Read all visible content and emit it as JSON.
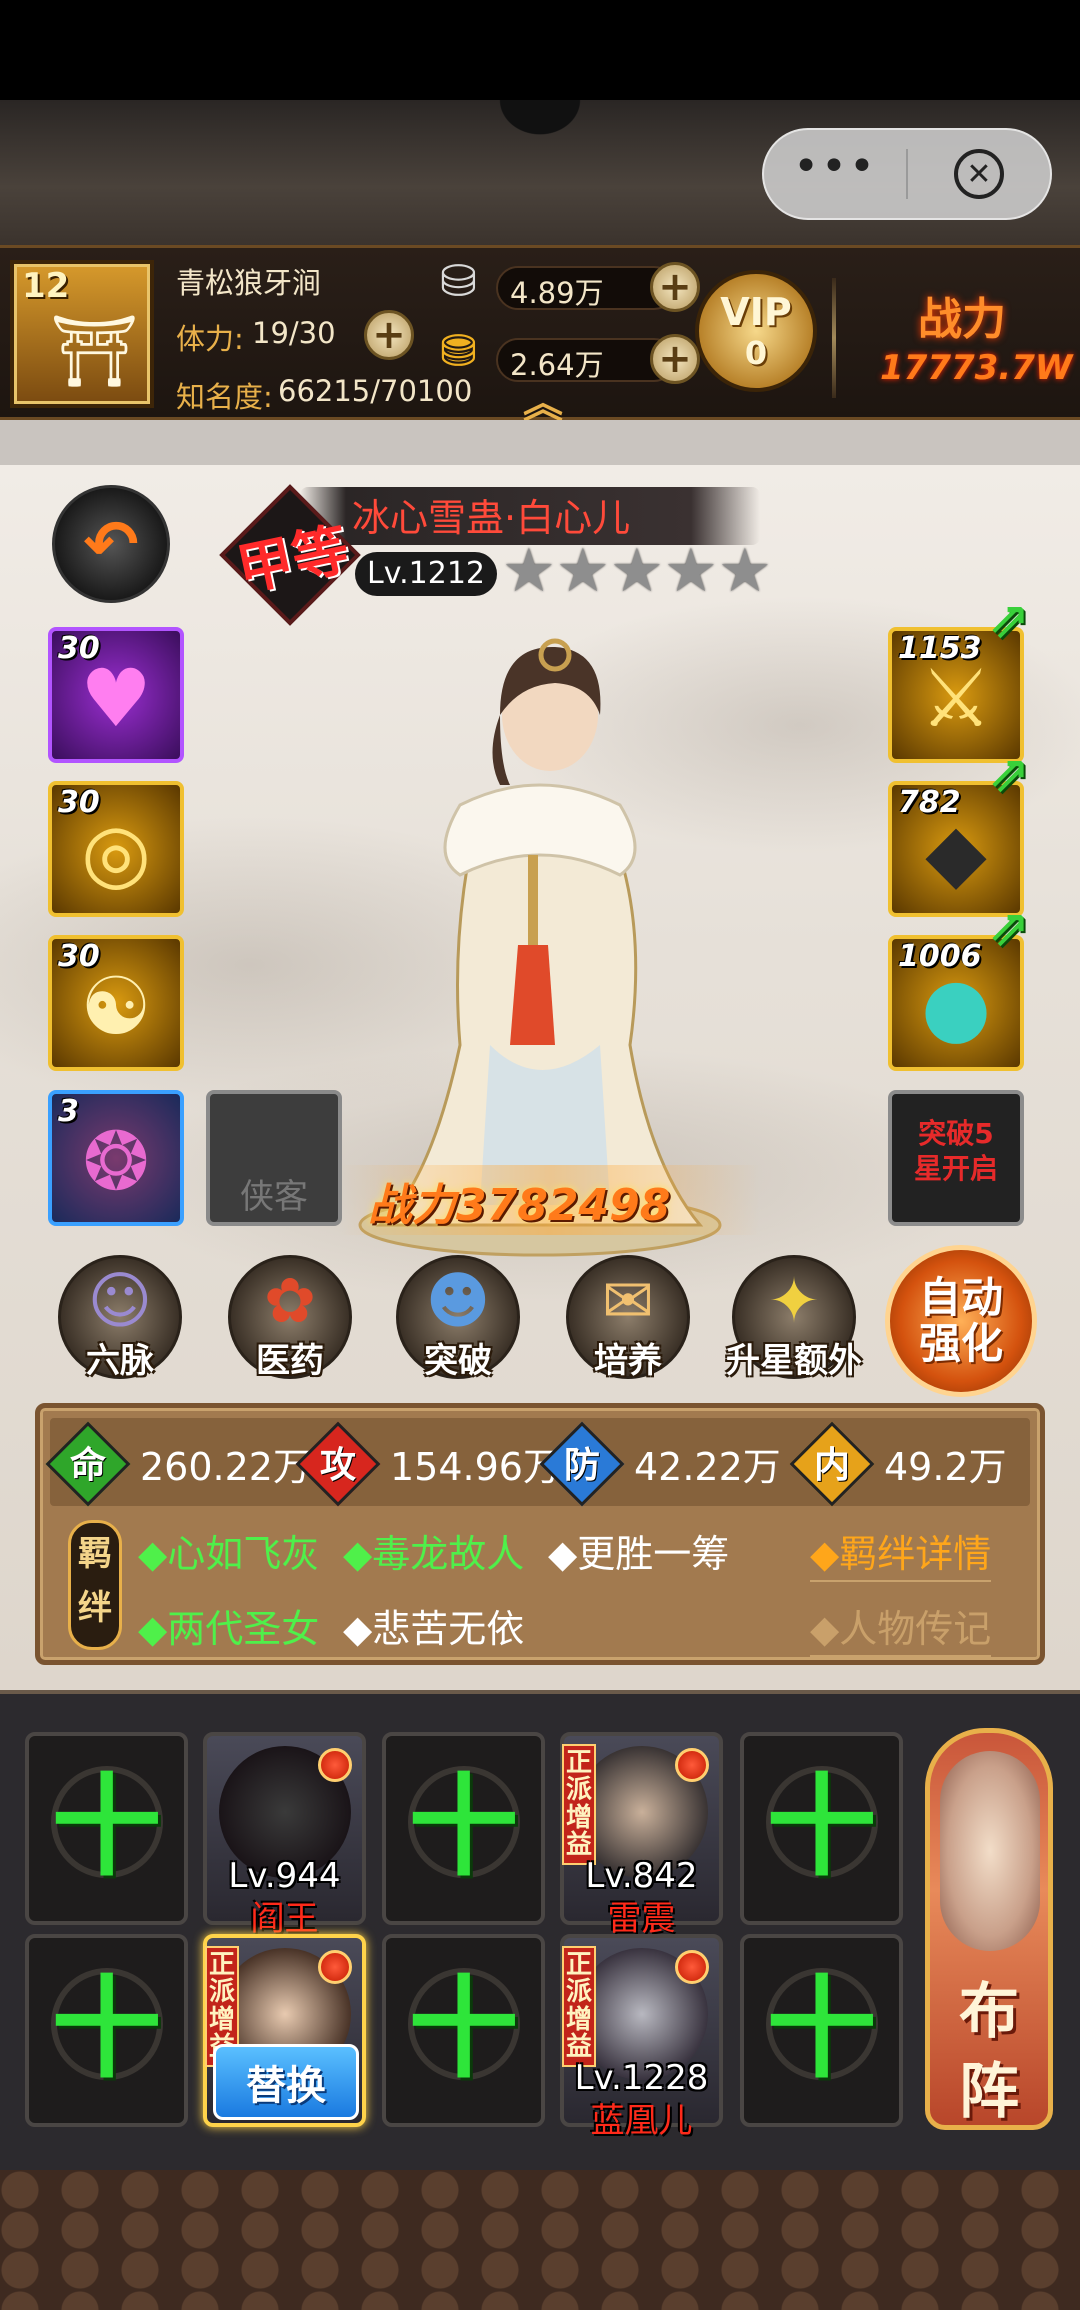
{
  "capsule": {
    "more_label": "•••",
    "close_label": "✕"
  },
  "status": {
    "level": "12",
    "location": "青松狼牙涧",
    "stamina_label": "体力:",
    "stamina_value": "19/30",
    "fame_label": "知名度:",
    "fame_value": "66215/70100",
    "silver": "4.89万",
    "gold": "2.64万",
    "vip_label": "VIP",
    "vip_level": "0",
    "power_label": "战力",
    "power_value": "17773.7W",
    "expand_icon": "chevron-up-icon"
  },
  "hero": {
    "rank": "甲等",
    "name": "冰心雪蛊·白心儿",
    "level": "Lv.1212",
    "stars": 5,
    "stars_lit": 0,
    "power": "战力3782498"
  },
  "left_slots": [
    {
      "level": "30",
      "icon": "heart-gem-icon",
      "glyph": "♥"
    },
    {
      "level": "30",
      "icon": "gold-swirl-icon",
      "glyph": "◎"
    },
    {
      "level": "30",
      "icon": "taiji-scroll-icon",
      "glyph": "☯"
    },
    {
      "level": "3",
      "icon": "purple-seal-icon",
      "glyph": "❂"
    }
  ],
  "empty_slot_label": "侠客",
  "right_slots": [
    {
      "level": "1153",
      "icon": "golden-weapon-icon",
      "glyph": "⚔"
    },
    {
      "level": "782",
      "icon": "dark-armor-icon",
      "glyph": "◆"
    },
    {
      "level": "1006",
      "icon": "jewel-accessory-icon",
      "glyph": "●"
    }
  ],
  "locked_slot_label": "突破5\n星开启",
  "functions": [
    {
      "label": "六脉",
      "icon": "meridian-icon",
      "glyph": "☺"
    },
    {
      "label": "医药",
      "icon": "herb-icon",
      "glyph": "✿"
    },
    {
      "label": "突破",
      "icon": "scholar-icon",
      "glyph": "☻"
    },
    {
      "label": "培养",
      "icon": "scroll-icon",
      "glyph": "✉"
    },
    {
      "label": "升星额外",
      "icon": "gift-box-icon",
      "glyph": "✦"
    }
  ],
  "auto_button": {
    "line1": "自动",
    "line2": "强化"
  },
  "stats": [
    {
      "icon_text": "命",
      "value": "260.22万",
      "color": "#2fa62a"
    },
    {
      "icon_text": "攻",
      "value": "154.96万",
      "color": "#d7261e"
    },
    {
      "icon_text": "防",
      "value": "42.22万",
      "color": "#2a7ad7"
    },
    {
      "icon_text": "内",
      "value": "49.2万",
      "color": "#e6a21a"
    }
  ],
  "bond_badge": "羁绊",
  "bonds": [
    {
      "text": "◆心如飞灰",
      "active": true
    },
    {
      "text": "◆毒龙故人",
      "active": true
    },
    {
      "text": "◆更胜一筹",
      "active": false
    },
    {
      "text": "◆两代圣女",
      "active": true
    },
    {
      "text": "◆悲苦无依",
      "active": false
    }
  ],
  "bond_links": {
    "details": "◆羁绊详情",
    "biography": "◆人物传记"
  },
  "formation": {
    "tag": "正派增益",
    "replace_label": "替换",
    "deploy_line1": "布",
    "deploy_line2": "阵",
    "members": [
      {
        "name": "阎王",
        "level": "Lv.944"
      },
      {
        "name": "雷震",
        "level": "Lv.842"
      },
      {
        "name": "",
        "level": ""
      },
      {
        "name": "蓝凰儿",
        "level": "Lv.1228"
      }
    ]
  },
  "colors": {
    "accent": "#ff7a1a",
    "panel": "#a27a4f",
    "add": "#2ee53a"
  }
}
